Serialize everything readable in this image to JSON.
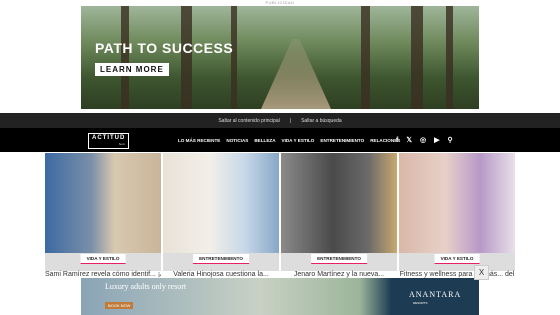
{
  "ad_label": "PUBLICIDAD",
  "top_ad": {
    "headline": "PATH TO SUCCESS",
    "cta": "LEARN MORE"
  },
  "skip_links": {
    "content": "Saltar al contenido principal",
    "separator": "|",
    "search": "Saltar a búsqueda"
  },
  "header": {
    "logo": "ACTITUD",
    "logo_sub": "fem",
    "menu": [
      "LO MÁS RECIENTE",
      "NOTICIAS",
      "BELLEZA",
      "VIDA Y ESTILO",
      "ENTRETENIMIENTO",
      "RELACIONES"
    ],
    "icons": {
      "facebook": "f",
      "x": "𝕏",
      "instagram": "◎",
      "youtube": "▶",
      "search": "⚲"
    }
  },
  "cards": [
    {
      "badge": "VIDA Y ESTILO",
      "title": "Sami Ramírez revela cómo identif... ¡Au"
    },
    {
      "badge": "ENTRETENIMIENTO",
      "title": "Valeria Hinojosa cuestiona la..."
    },
    {
      "badge": "ENTRETENIMIENTO",
      "title": "Jenaro Martínez y la nueva..."
    },
    {
      "badge": "VIDA Y ESTILO",
      "title": "Fitness y wellness para mamás... del"
    }
  ],
  "bottom_ad": {
    "text": "Luxury adults only resort",
    "cta": "BOOK NOW",
    "brand": "ANANTARA",
    "brand_sub": "RESORTS"
  },
  "close_label": "X"
}
